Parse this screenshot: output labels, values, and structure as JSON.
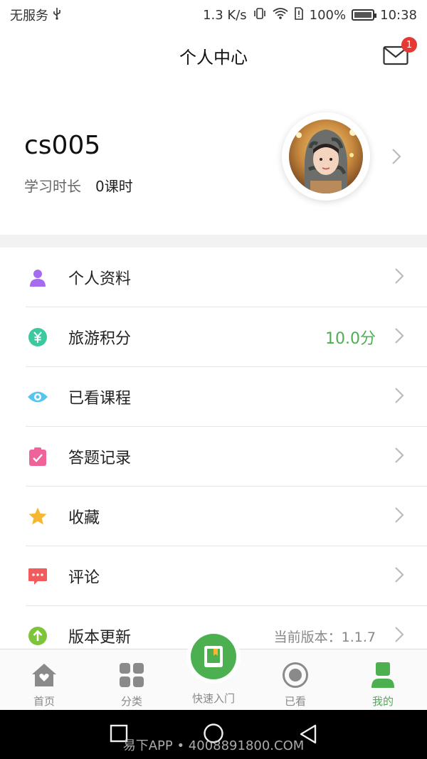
{
  "status_bar": {
    "carrier": "无服务",
    "speed": "1.3 K/s",
    "battery": "100%",
    "time": "10:38"
  },
  "header": {
    "title": "个人中心",
    "mail_badge": "1"
  },
  "profile": {
    "username": "cs005",
    "study_label": "学习时长",
    "study_value": "0课时"
  },
  "menu": {
    "items": [
      {
        "label": "个人资料",
        "icon": "person-icon",
        "value": ""
      },
      {
        "label": "旅游积分",
        "icon": "yen-coin-icon",
        "value": "10.0分"
      },
      {
        "label": "已看课程",
        "icon": "eye-icon",
        "value": ""
      },
      {
        "label": "答题记录",
        "icon": "clipboard-check-icon",
        "value": ""
      },
      {
        "label": "收藏",
        "icon": "star-icon",
        "value": ""
      },
      {
        "label": "评论",
        "icon": "comment-icon",
        "value": ""
      },
      {
        "label": "版本更新",
        "icon": "upgrade-icon",
        "value": "当前版本：1.1.7"
      }
    ]
  },
  "bottom_nav": {
    "items": [
      {
        "label": "首页",
        "icon": "home-icon"
      },
      {
        "label": "分类",
        "icon": "grid-icon"
      },
      {
        "label": "快速入门",
        "icon": "book-icon"
      },
      {
        "label": "已看",
        "icon": "record-icon"
      },
      {
        "label": "我的",
        "icon": "user-icon"
      }
    ]
  },
  "watermark": "易下APP • 4008891800.COM",
  "colors": {
    "accent_green": "#4caf50",
    "badge_red": "#e53935",
    "person_purple": "#a56cf0",
    "yen_teal": "#3cc9a0",
    "eye_blue": "#57c5f0",
    "clipboard_pink": "#f0639a",
    "star_orange": "#f7b731",
    "comment_red": "#f25b5b",
    "upgrade_green": "#7dc43a"
  }
}
